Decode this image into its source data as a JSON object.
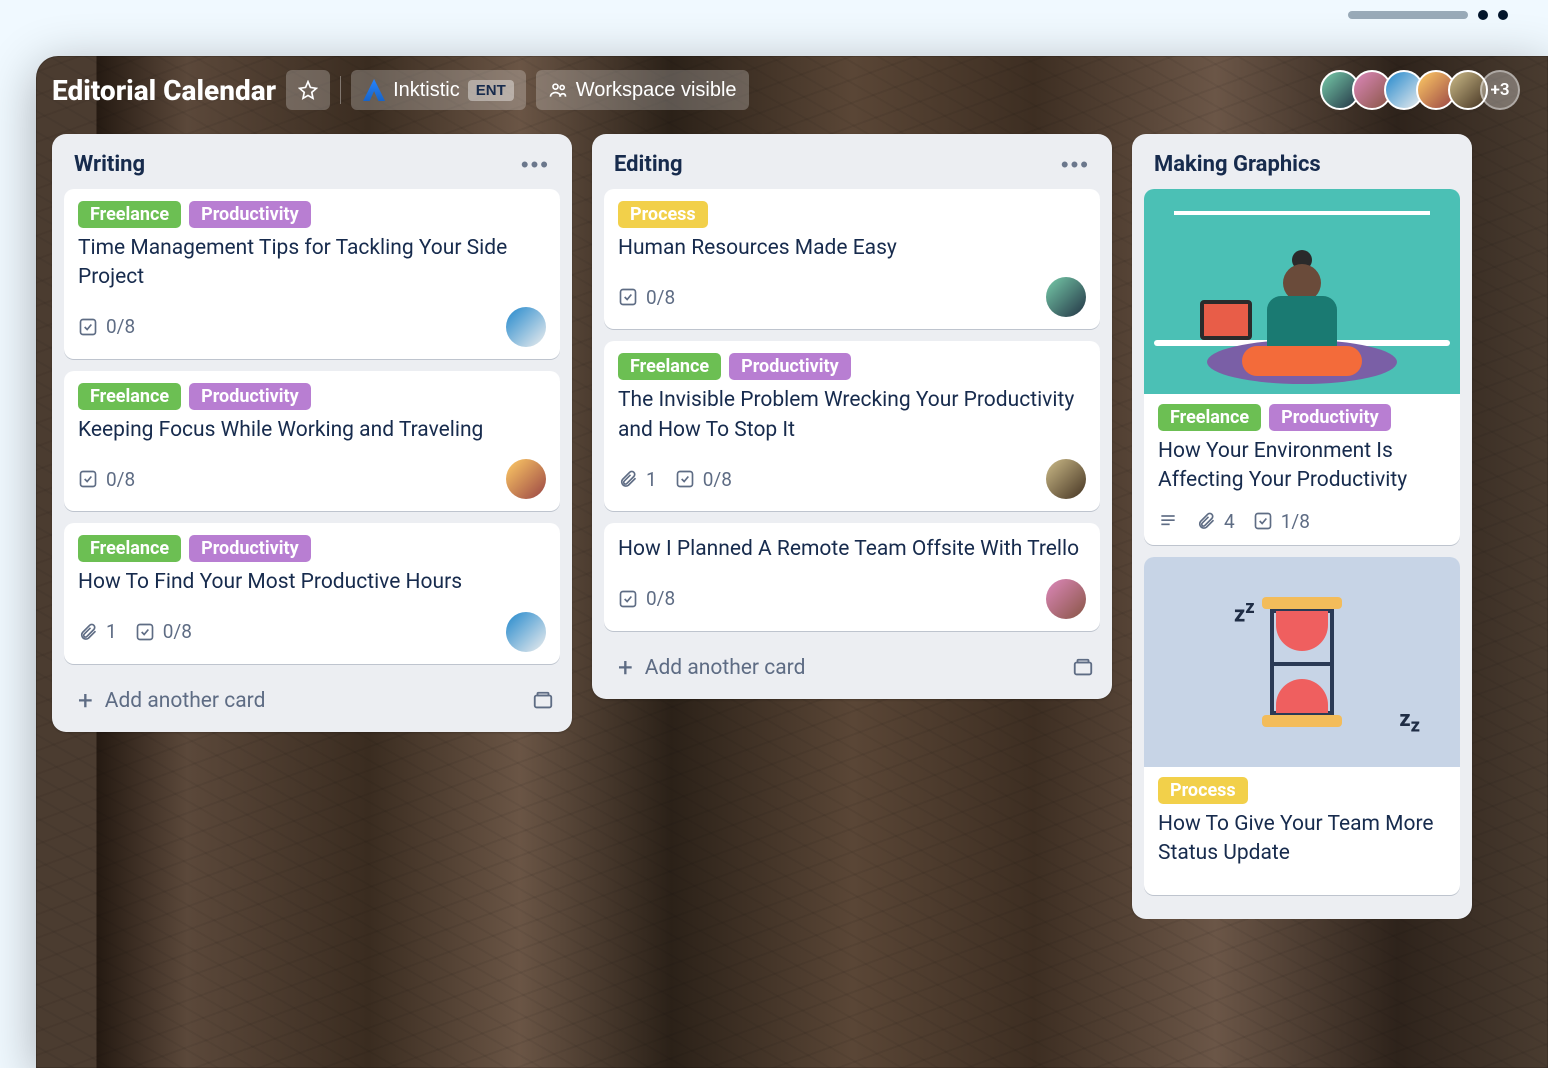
{
  "header": {
    "board_title": "Editorial Calendar",
    "workspace_name": "Inktistic",
    "workspace_tier": "ENT",
    "visibility_label": "Workspace visible",
    "extra_members": "+3"
  },
  "labels": {
    "freelance": "Freelance",
    "productivity": "Productivity",
    "process": "Process"
  },
  "add_card_label": "Add another card",
  "lists": [
    {
      "title": "Writing",
      "cards": [
        {
          "labels": [
            "freelance",
            "productivity"
          ],
          "title": "Time Management Tips for Tackling Your Side Project",
          "checklist": "0/8",
          "avatar": "a3"
        },
        {
          "labels": [
            "freelance",
            "productivity"
          ],
          "title": "Keeping Focus While Working and Traveling",
          "checklist": "0/8",
          "avatar": "a4"
        },
        {
          "labels": [
            "freelance",
            "productivity"
          ],
          "title": "How To Find Your Most Productive Hours",
          "attachments": "1",
          "checklist": "0/8",
          "avatar": "a3"
        }
      ]
    },
    {
      "title": "Editing",
      "cards": [
        {
          "labels": [
            "process"
          ],
          "title": "Human Resources Made Easy",
          "checklist": "0/8",
          "avatar": "a1"
        },
        {
          "labels": [
            "freelance",
            "productivity"
          ],
          "title": "The Invisible Problem Wrecking Your Productivity and How To Stop It",
          "attachments": "1",
          "checklist": "0/8",
          "avatar": "a5"
        },
        {
          "labels": [],
          "title": "How I Planned A Remote Team Offsite With Trello",
          "checklist": "0/8",
          "avatar": "a2"
        }
      ]
    },
    {
      "title": "Making Graphics",
      "cards": [
        {
          "cover": "meditation",
          "labels": [
            "freelance",
            "productivity"
          ],
          "title": "How Your Environment Is Affecting Your Productivity",
          "description": true,
          "attachments": "4",
          "checklist": "1/8"
        },
        {
          "cover": "hourglass",
          "labels": [
            "process"
          ],
          "title": "How To Give Your Team More Status Update"
        }
      ]
    }
  ]
}
